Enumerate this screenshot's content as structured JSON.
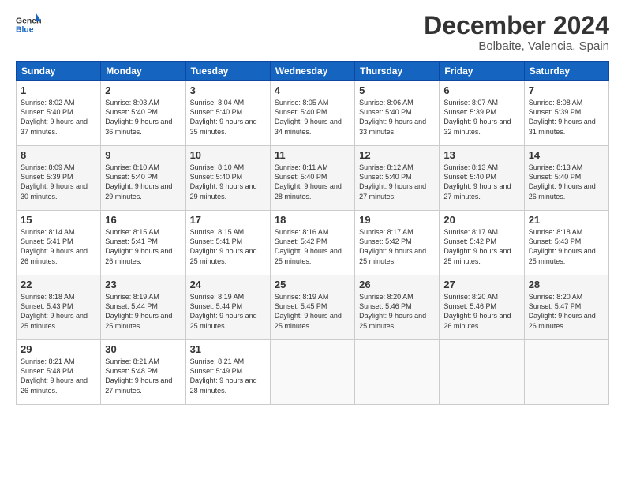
{
  "header": {
    "logo_general": "General",
    "logo_blue": "Blue",
    "title": "December 2024",
    "location": "Bolbaite, Valencia, Spain"
  },
  "columns": [
    "Sunday",
    "Monday",
    "Tuesday",
    "Wednesday",
    "Thursday",
    "Friday",
    "Saturday"
  ],
  "weeks": [
    [
      {
        "day": "1",
        "sunrise": "8:02 AM",
        "sunset": "5:40 PM",
        "daylight": "9 hours and 37 minutes."
      },
      {
        "day": "2",
        "sunrise": "8:03 AM",
        "sunset": "5:40 PM",
        "daylight": "9 hours and 36 minutes."
      },
      {
        "day": "3",
        "sunrise": "8:04 AM",
        "sunset": "5:40 PM",
        "daylight": "9 hours and 35 minutes."
      },
      {
        "day": "4",
        "sunrise": "8:05 AM",
        "sunset": "5:40 PM",
        "daylight": "9 hours and 34 minutes."
      },
      {
        "day": "5",
        "sunrise": "8:06 AM",
        "sunset": "5:40 PM",
        "daylight": "9 hours and 33 minutes."
      },
      {
        "day": "6",
        "sunrise": "8:07 AM",
        "sunset": "5:39 PM",
        "daylight": "9 hours and 32 minutes."
      },
      {
        "day": "7",
        "sunrise": "8:08 AM",
        "sunset": "5:39 PM",
        "daylight": "9 hours and 31 minutes."
      }
    ],
    [
      {
        "day": "8",
        "sunrise": "8:09 AM",
        "sunset": "5:39 PM",
        "daylight": "9 hours and 30 minutes."
      },
      {
        "day": "9",
        "sunrise": "8:10 AM",
        "sunset": "5:40 PM",
        "daylight": "9 hours and 29 minutes."
      },
      {
        "day": "10",
        "sunrise": "8:10 AM",
        "sunset": "5:40 PM",
        "daylight": "9 hours and 29 minutes."
      },
      {
        "day": "11",
        "sunrise": "8:11 AM",
        "sunset": "5:40 PM",
        "daylight": "9 hours and 28 minutes."
      },
      {
        "day": "12",
        "sunrise": "8:12 AM",
        "sunset": "5:40 PM",
        "daylight": "9 hours and 27 minutes."
      },
      {
        "day": "13",
        "sunrise": "8:13 AM",
        "sunset": "5:40 PM",
        "daylight": "9 hours and 27 minutes."
      },
      {
        "day": "14",
        "sunrise": "8:13 AM",
        "sunset": "5:40 PM",
        "daylight": "9 hours and 26 minutes."
      }
    ],
    [
      {
        "day": "15",
        "sunrise": "8:14 AM",
        "sunset": "5:41 PM",
        "daylight": "9 hours and 26 minutes."
      },
      {
        "day": "16",
        "sunrise": "8:15 AM",
        "sunset": "5:41 PM",
        "daylight": "9 hours and 26 minutes."
      },
      {
        "day": "17",
        "sunrise": "8:15 AM",
        "sunset": "5:41 PM",
        "daylight": "9 hours and 25 minutes."
      },
      {
        "day": "18",
        "sunrise": "8:16 AM",
        "sunset": "5:42 PM",
        "daylight": "9 hours and 25 minutes."
      },
      {
        "day": "19",
        "sunrise": "8:17 AM",
        "sunset": "5:42 PM",
        "daylight": "9 hours and 25 minutes."
      },
      {
        "day": "20",
        "sunrise": "8:17 AM",
        "sunset": "5:42 PM",
        "daylight": "9 hours and 25 minutes."
      },
      {
        "day": "21",
        "sunrise": "8:18 AM",
        "sunset": "5:43 PM",
        "daylight": "9 hours and 25 minutes."
      }
    ],
    [
      {
        "day": "22",
        "sunrise": "8:18 AM",
        "sunset": "5:43 PM",
        "daylight": "9 hours and 25 minutes."
      },
      {
        "day": "23",
        "sunrise": "8:19 AM",
        "sunset": "5:44 PM",
        "daylight": "9 hours and 25 minutes."
      },
      {
        "day": "24",
        "sunrise": "8:19 AM",
        "sunset": "5:44 PM",
        "daylight": "9 hours and 25 minutes."
      },
      {
        "day": "25",
        "sunrise": "8:19 AM",
        "sunset": "5:45 PM",
        "daylight": "9 hours and 25 minutes."
      },
      {
        "day": "26",
        "sunrise": "8:20 AM",
        "sunset": "5:46 PM",
        "daylight": "9 hours and 25 minutes."
      },
      {
        "day": "27",
        "sunrise": "8:20 AM",
        "sunset": "5:46 PM",
        "daylight": "9 hours and 26 minutes."
      },
      {
        "day": "28",
        "sunrise": "8:20 AM",
        "sunset": "5:47 PM",
        "daylight": "9 hours and 26 minutes."
      }
    ],
    [
      {
        "day": "29",
        "sunrise": "8:21 AM",
        "sunset": "5:48 PM",
        "daylight": "9 hours and 26 minutes."
      },
      {
        "day": "30",
        "sunrise": "8:21 AM",
        "sunset": "5:48 PM",
        "daylight": "9 hours and 27 minutes."
      },
      {
        "day": "31",
        "sunrise": "8:21 AM",
        "sunset": "5:49 PM",
        "daylight": "9 hours and 28 minutes."
      },
      null,
      null,
      null,
      null
    ]
  ]
}
